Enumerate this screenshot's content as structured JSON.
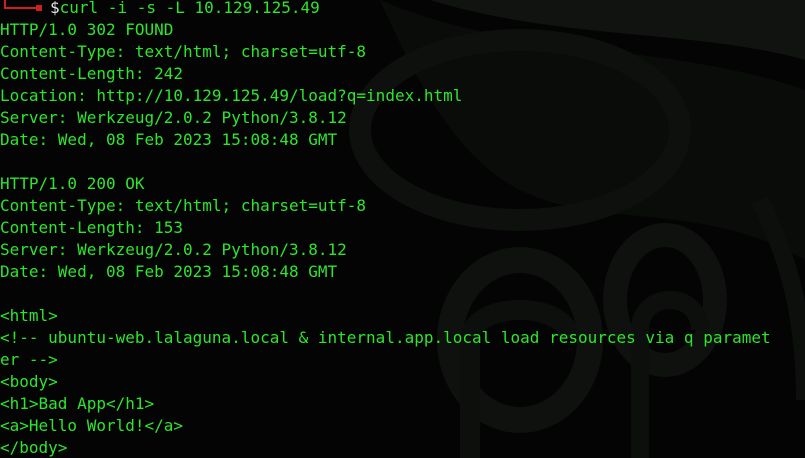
{
  "prompt": {
    "symbol": "$",
    "command": "curl -i -s -L 10.129.125.49"
  },
  "output": {
    "lines": [
      "HTTP/1.0 302 FOUND",
      "Content-Type: text/html; charset=utf-8",
      "Content-Length: 242",
      "Location: http://10.129.125.49/load?q=index.html",
      "Server: Werkzeug/2.0.2 Python/3.8.12",
      "Date: Wed, 08 Feb 2023 15:08:48 GMT",
      "",
      "HTTP/1.0 200 OK",
      "Content-Type: text/html; charset=utf-8",
      "Content-Length: 153",
      "Server: Werkzeug/2.0.2 Python/3.8.12",
      "Date: Wed, 08 Feb 2023 15:08:48 GMT",
      "",
      "<html>",
      "<!-- ubuntu-web.lalaguna.local & internal.app.local load resources via q paramet",
      "er -->",
      "<body>",
      "<h1>Bad App</h1>",
      "<a>Hello World!</a>",
      "</body>"
    ]
  },
  "colors": {
    "text": "#2ee52e",
    "prompt_corner": "#d11f1f",
    "dollar": "#e6e6e6",
    "background": "#030403"
  }
}
